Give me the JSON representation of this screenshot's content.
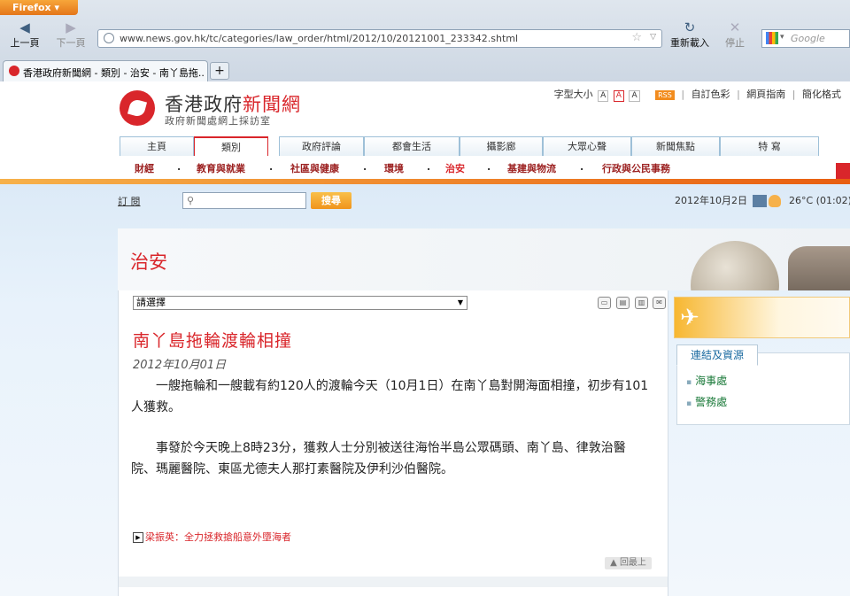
{
  "browser": {
    "menu_button": "Firefox",
    "back_label": "上一頁",
    "forward_label": "下一頁",
    "reload_label": "重新載入",
    "stop_label": "停止",
    "url": "www.news.gov.hk/tc/categories/law_order/html/2012/10/20121001_233342.shtml",
    "search_placeholder": "Google",
    "tab_title": "香港政府新聞網 - 類別 - 治安 - 南丫島拖...",
    "new_tab": "+"
  },
  "site": {
    "title_main": "香港政府",
    "title_red": "新聞網",
    "subtitle": "政府新聞處網上採訪室",
    "font_size_label": "字型大小",
    "size_small": "A",
    "size_medium": "A",
    "size_large": "A",
    "rss": "RSS",
    "custom_color": "自訂色彩",
    "sitemap": "網頁指南",
    "simplified": "簡化格式"
  },
  "nav": {
    "tabs": [
      "主頁",
      "類別",
      "政府評論",
      "都會生活",
      "攝影廊",
      "大眾心聲",
      "新聞焦點",
      "特 寫"
    ],
    "sub_items": [
      "財經",
      "教育與就業",
      "社區與健康",
      "環境",
      "治安",
      "基建與物流",
      "行政與公民事務"
    ],
    "separator": "."
  },
  "utility": {
    "subscribe": "訂 閱",
    "search_button": "搜尋",
    "date": "2012年10月2日",
    "temperature": "26°C (01:02)"
  },
  "category": {
    "title": "治安"
  },
  "article": {
    "lang_select": "請選擇",
    "title": "南丫島拖輪渡輪相撞",
    "date": "2012年10月01日",
    "paragraphs": [
      "一艘拖輪和一艘載有約120人的渡輪今天（10月1日）在南丫島對開海面相撞，初步有101人獲救。",
      "事發於今天晚上8時23分，獲救人士分別被送往海怡半島公眾碼頭、南丫島、律敦治醫院、瑪麗醫院、東區尤德夫人那打素醫院及伊利沙伯醫院。"
    ],
    "related_link": "梁振英：全力拯救搶船意外墮海者",
    "back_to_top": "回最上"
  },
  "sidebar": {
    "links_title": "連結及資源",
    "links": [
      "海事處",
      "警務處"
    ]
  },
  "colors": {
    "brand_red": "#d9262b",
    "accent_orange": "#f0941c",
    "link_green": "#1b7a3a"
  },
  "icons": [
    "back-arrow-icon",
    "forward-arrow-icon",
    "reload-icon",
    "stop-icon",
    "globe-icon",
    "bookmark-star-icon",
    "google-icon",
    "magnifier-icon",
    "weather-icon",
    "flame-icon",
    "share-icon",
    "print-icon",
    "print-friendly-icon",
    "email-icon",
    "plane-icon",
    "play-icon"
  ]
}
